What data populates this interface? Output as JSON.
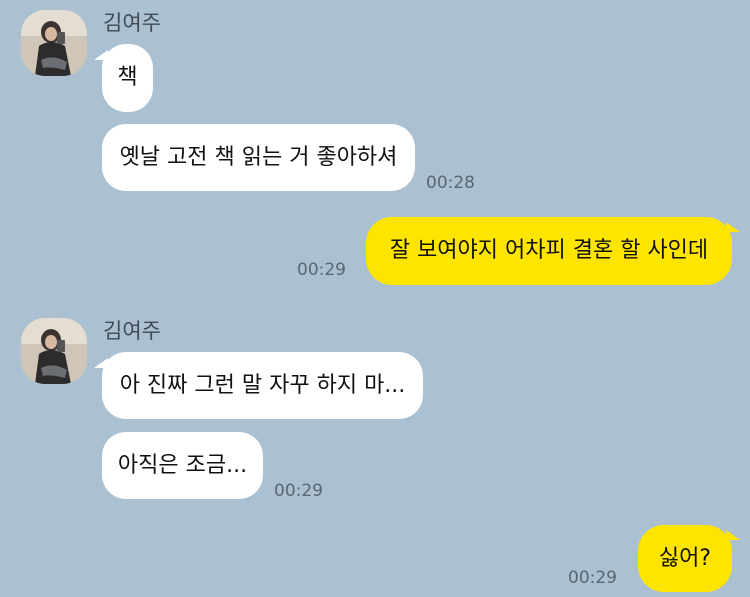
{
  "messages": {
    "m1": {
      "sender": "김여주",
      "text": "책"
    },
    "m2": {
      "text": "옛날 고전 책 읽는 거 좋아하셔",
      "time": "00:28"
    },
    "m3": {
      "text": "잘 보여야지 어차피 결혼 할 사인데",
      "time": "00:29"
    },
    "m4": {
      "sender": "김여주",
      "text": "아 진짜 그런 말 자꾸 하지 마..."
    },
    "m5": {
      "text": "아직은 조금...",
      "time": "00:29"
    },
    "m6": {
      "text": "싫어?",
      "time": "00:29"
    }
  },
  "colors": {
    "background": "#abc1d1",
    "incoming_bubble": "#ffffff",
    "outgoing_bubble": "#fee500"
  },
  "icons": {
    "avatar": "profile-photo"
  }
}
